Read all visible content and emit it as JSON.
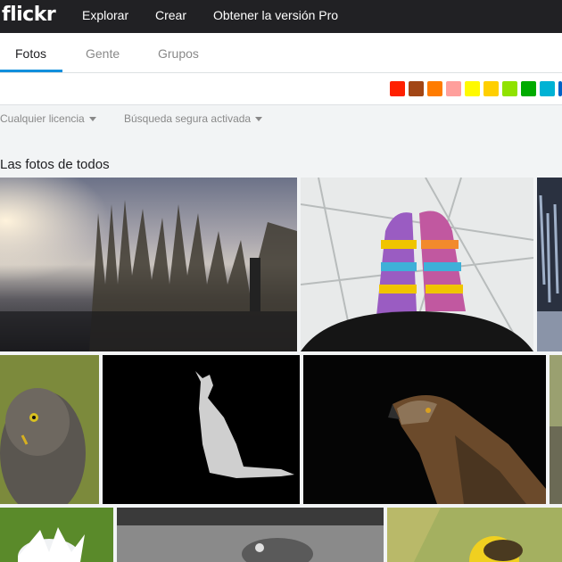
{
  "topnav": {
    "logo": "flickr",
    "links": [
      "Explorar",
      "Crear",
      "Obtener la versión Pro"
    ]
  },
  "tabs": [
    "Fotos",
    "Gente",
    "Grupos"
  ],
  "colors": [
    "#ff2000",
    "#a24615",
    "#ff7c00",
    "#ff9f9c",
    "#fffa00",
    "#ffcf00",
    "#90e200",
    "#00ab00",
    "#00b2d4",
    "#0062c6"
  ],
  "filters": {
    "license": "Cualquier licencia",
    "safe_search": "Búsqueda segura activada"
  },
  "section_title": "Las fotos de todos"
}
